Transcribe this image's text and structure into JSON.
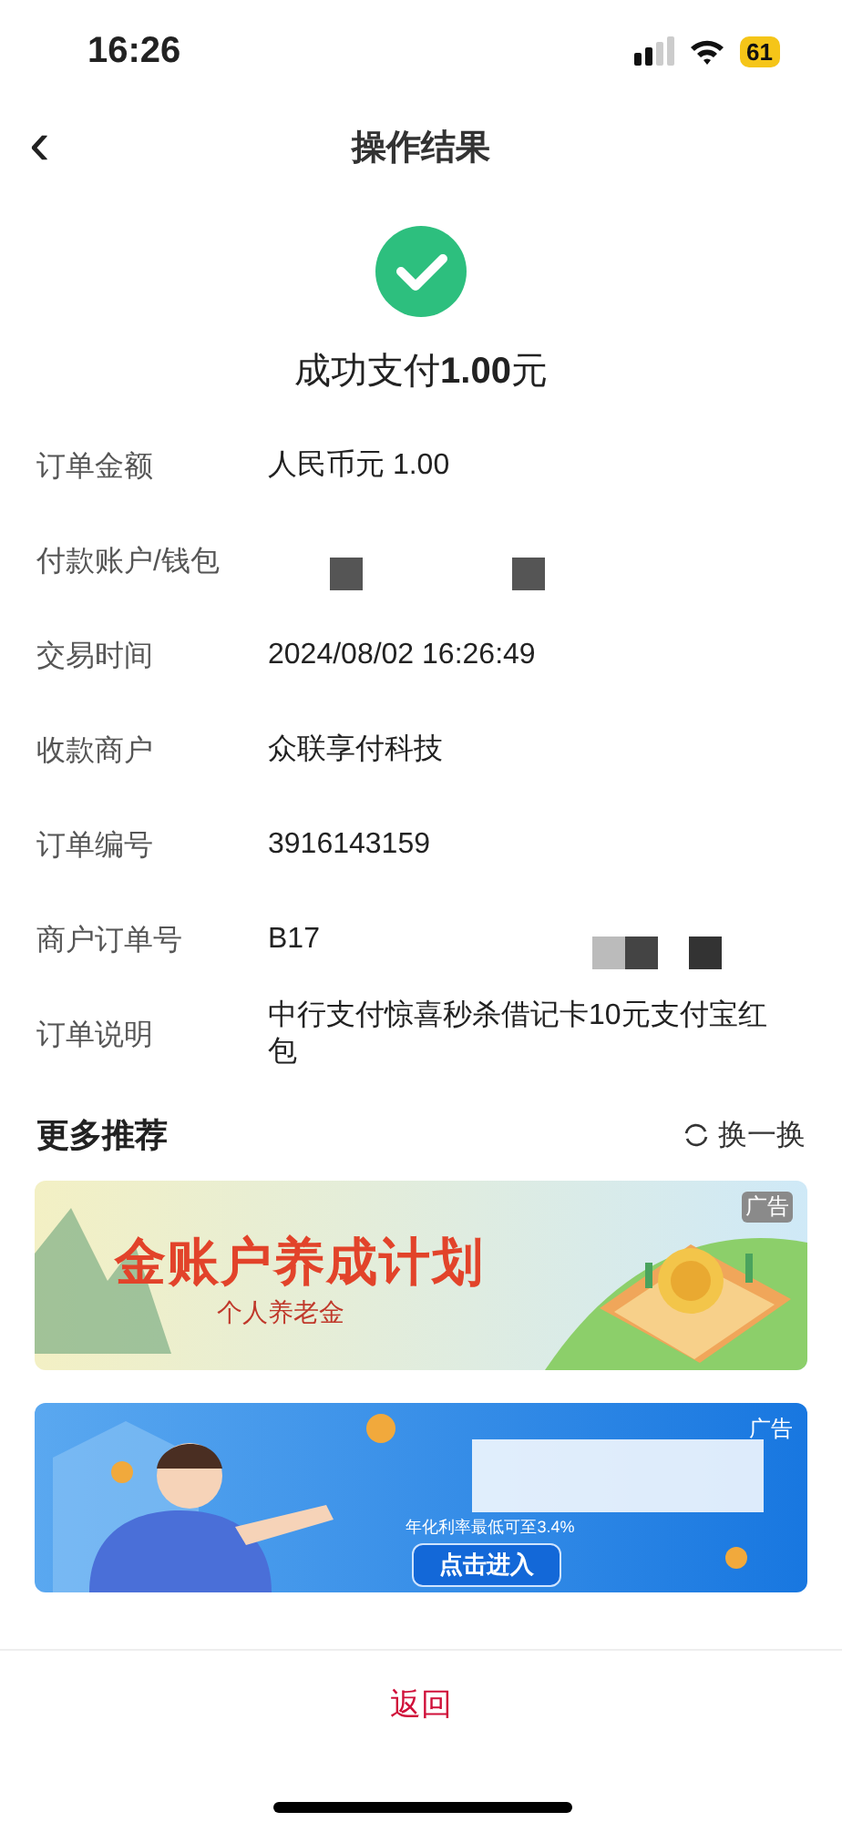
{
  "status_bar": {
    "time": "16:26",
    "battery": "61"
  },
  "header": {
    "back_icon": "‹",
    "title": "操作结果"
  },
  "result": {
    "prefix": "成功支付",
    "amount": "1.00",
    "suffix": "元"
  },
  "details": [
    {
      "label": "订单金额",
      "kind": "text",
      "value": "人民币元 1.00"
    },
    {
      "label": "付款账户/钱包",
      "kind": "masked"
    },
    {
      "label": "交易时间",
      "kind": "text",
      "value": "2024/08/02 16:26:49"
    },
    {
      "label": "收款商户",
      "kind": "text",
      "value": "众联享付科技"
    },
    {
      "label": "订单编号",
      "kind": "text",
      "value": "3916143159"
    },
    {
      "label": "商户订单号",
      "kind": "partly-masked",
      "value": "B17"
    },
    {
      "label": "订单说明",
      "kind": "text",
      "value": "中行支付惊喜秒杀借记卡10元支付宝红包"
    }
  ],
  "recommend": {
    "title": "更多推荐",
    "refresh": "换一换"
  },
  "banners": [
    {
      "kind": "gold",
      "title": "金账户养成计划",
      "subtitle": "个人养老金",
      "ad": "广告"
    },
    {
      "kind": "loan",
      "ad": "广告",
      "subtitle": "年化利率最低可至3.4%",
      "button": "点击进入"
    }
  ],
  "bottom": {
    "button": "返回"
  }
}
